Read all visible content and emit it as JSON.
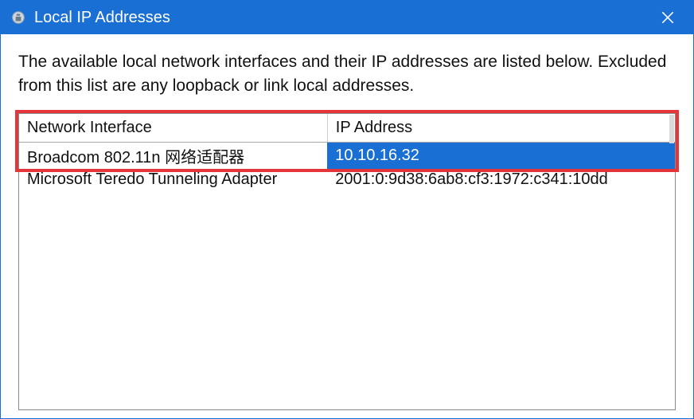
{
  "titlebar": {
    "title": "Local IP Addresses"
  },
  "description": "The available local network interfaces and their IP addresses are listed below. Excluded from this list are any loopback or link local addresses.",
  "table": {
    "headers": {
      "interface": "Network Interface",
      "ip": "IP Address"
    },
    "rows": [
      {
        "interface": "Broadcom 802.11n 网络适配器",
        "ip": "10.10.16.32",
        "selected": true
      },
      {
        "interface": "Microsoft Teredo Tunneling Adapter",
        "ip": "2001:0:9d38:6ab8:cf3:1972:c341:10dd",
        "selected": false
      }
    ]
  }
}
